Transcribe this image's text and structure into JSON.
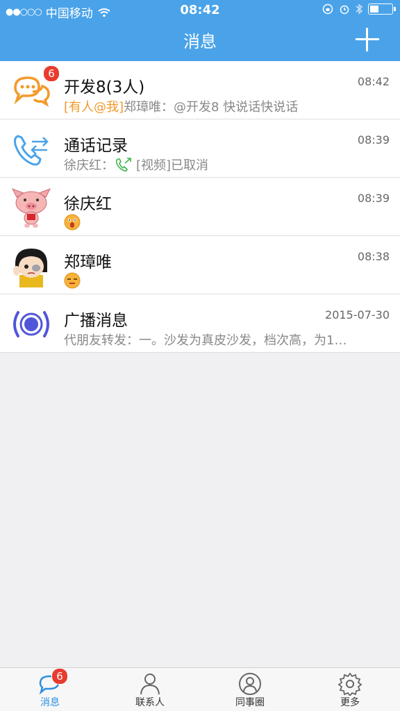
{
  "status": {
    "carrier": "中国移动",
    "time": "08:42"
  },
  "nav": {
    "title": "消息",
    "add_label": "+"
  },
  "conversations": [
    {
      "name": "开发8(3人)",
      "time": "08:42",
      "mention": "[有人@我]",
      "preview": "郑璋唯：@开发8 快说话快说话",
      "badge": "6",
      "icon": "group-chat-icon"
    },
    {
      "name": "通话记录",
      "time": "08:39",
      "preview_prefix": "徐庆红：",
      "preview": "[视频]已取消",
      "icon": "call-log-icon"
    },
    {
      "name": "徐庆红",
      "time": "08:39",
      "icon": "pig-avatar"
    },
    {
      "name": "郑璋唯",
      "time": "08:38",
      "icon": "cartoon-girl-avatar"
    },
    {
      "name": "广播消息",
      "time": "2015-07-30",
      "preview": "代朋友转发：一。沙发为真皮沙发，档次高，为1…",
      "icon": "broadcast-icon"
    }
  ],
  "tabbar": {
    "tabs": [
      {
        "label": "消息",
        "badge": "6",
        "icon": "messages-icon"
      },
      {
        "label": "联系人",
        "icon": "contacts-icon"
      },
      {
        "label": "同事圈",
        "icon": "colleagues-icon"
      },
      {
        "label": "更多",
        "icon": "gear-icon"
      }
    ]
  },
  "colors": {
    "header": "#4aa3e9",
    "accent": "#2d8fe0",
    "badge": "#e83b2f",
    "mention": "#f09a2a"
  }
}
